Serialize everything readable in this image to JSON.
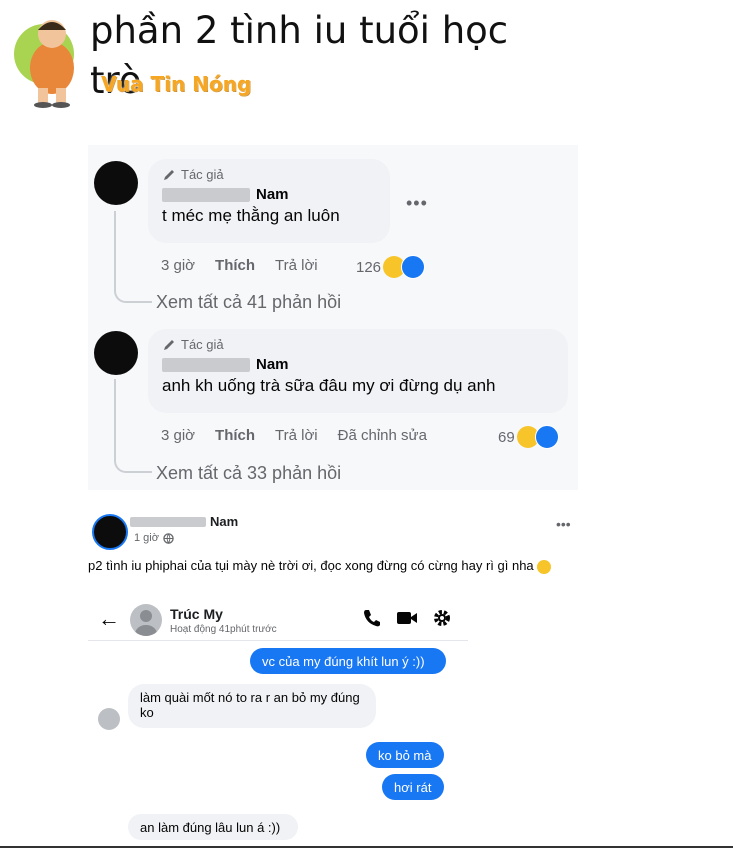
{
  "header": {
    "title": "phần 2 tình iu tuổi học trò",
    "brand": "Vua Tin Nóng"
  },
  "comments": [
    {
      "author_tag": "Tác giả",
      "author_name": "Nam",
      "text": "t méc mẹ thằng an luôn",
      "time": "3 giờ",
      "like_label": "Thích",
      "reply_label": "Trả lời",
      "edited_label": "",
      "reaction_count": "126",
      "see_all": "Xem tất cả 41 phản hồi"
    },
    {
      "author_tag": "Tác giả",
      "author_name": "Nam",
      "text": "anh kh uống trà sữa đâu my ơi đừng dụ anh",
      "time": "3 giờ",
      "like_label": "Thích",
      "reply_label": "Trả lời",
      "edited_label": "Đã chỉnh sửa",
      "reaction_count": "69",
      "see_all": "Xem tất cả 33 phản hồi"
    }
  ],
  "post": {
    "author_name": "Nam",
    "time": "1 giờ",
    "text": "p2 tình iu phiphai của tụi mày nè trời ơi, đọc xong đừng có cừng hay rì gì nha"
  },
  "messenger": {
    "contact_name": "Trúc My",
    "status": "Hoạt động 41phút trước",
    "messages": [
      {
        "dir": "out",
        "text": "vc của my đúng khít lun ý :))"
      },
      {
        "dir": "in",
        "text": "làm quài mốt nó to ra r an bỏ my đúng ko"
      },
      {
        "dir": "out",
        "text": "ko bỏ mà"
      },
      {
        "dir": "out",
        "text": "hơi rát"
      },
      {
        "dir": "in",
        "text": "an làm đúng lâu lun á :))"
      }
    ]
  },
  "colors": {
    "brand": "#f5a623",
    "messenger_blue": "#1877f2",
    "bubble_gray": "#f0f2f5"
  }
}
